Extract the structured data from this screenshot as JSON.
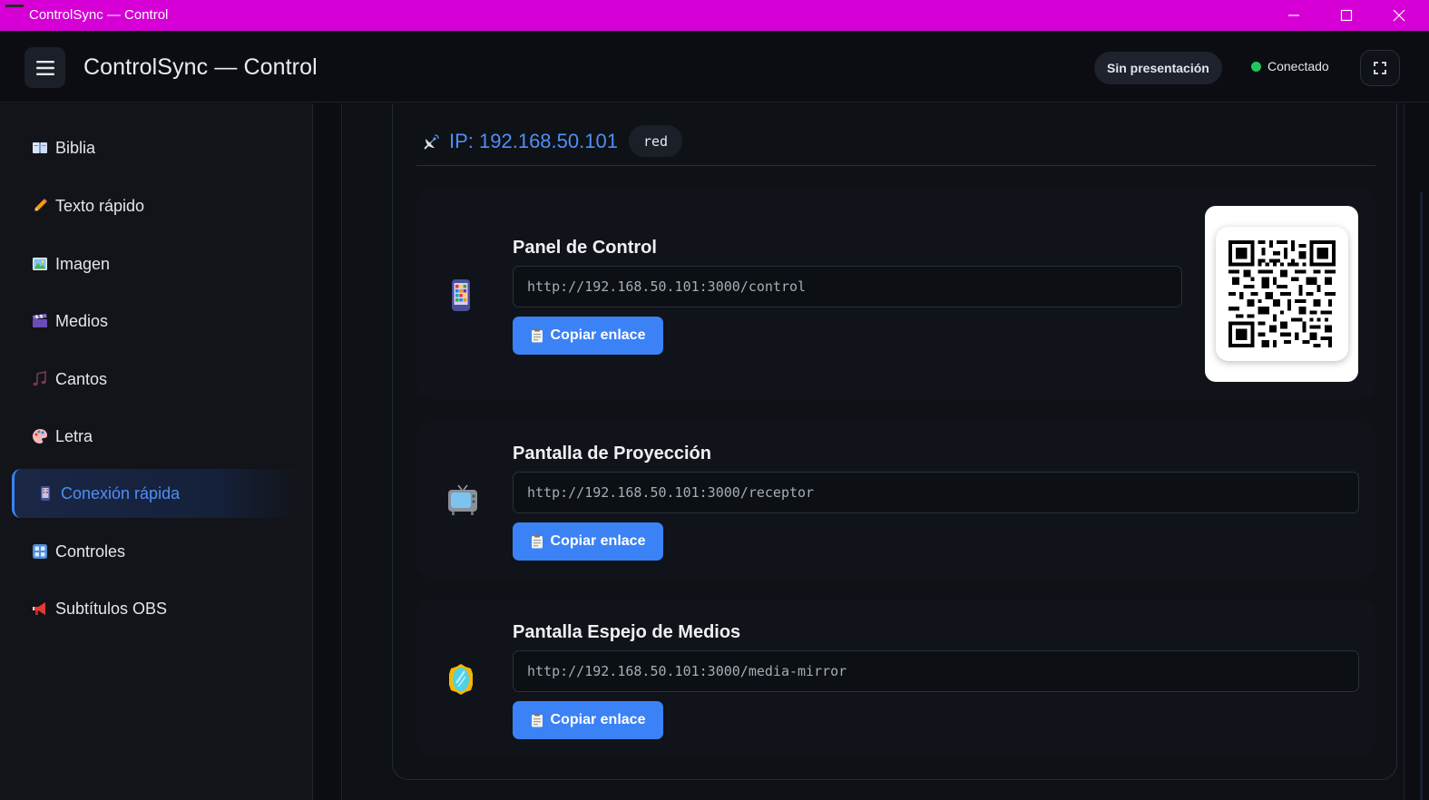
{
  "window": {
    "title": "ControlSync — Control"
  },
  "header": {
    "title": "ControlSync — Control",
    "presentation_status": "Sin presentación",
    "connection_status": "Conectado",
    "connection_color": "#22c55e"
  },
  "sidebar": {
    "items": [
      {
        "label": "Biblia",
        "icon": "book-icon"
      },
      {
        "label": "Texto rápido",
        "icon": "pencil-icon"
      },
      {
        "label": "Imagen",
        "icon": "picture-icon"
      },
      {
        "label": "Medios",
        "icon": "clapper-icon"
      },
      {
        "label": "Cantos",
        "icon": "music-icon"
      },
      {
        "label": "Letra",
        "icon": "palette-icon"
      },
      {
        "label": "Conexión rápida",
        "icon": "phone-icon",
        "active": true
      },
      {
        "label": "Controles",
        "icon": "keypad-icon"
      },
      {
        "label": "Subtítulos OBS",
        "icon": "megaphone-icon"
      }
    ]
  },
  "connection": {
    "ip_label": "IP: 192.168.50.101",
    "network_badge": "red",
    "links": [
      {
        "label": "Panel de Control",
        "url": "http://192.168.50.101:3000/control",
        "button": "Copiar enlace",
        "icon": "phone-icon"
      },
      {
        "label": "Pantalla de Proyección",
        "url": "http://192.168.50.101:3000/receptor",
        "button": "Copiar enlace",
        "icon": "tv-icon"
      },
      {
        "label": "Pantalla Espejo de Medios",
        "url": "http://192.168.50.101:3000/media-mirror",
        "button": "Copiar enlace",
        "icon": "mirror-icon"
      }
    ]
  },
  "colors": {
    "accent": "#3b82f6",
    "titlebar": "#d600d6"
  }
}
